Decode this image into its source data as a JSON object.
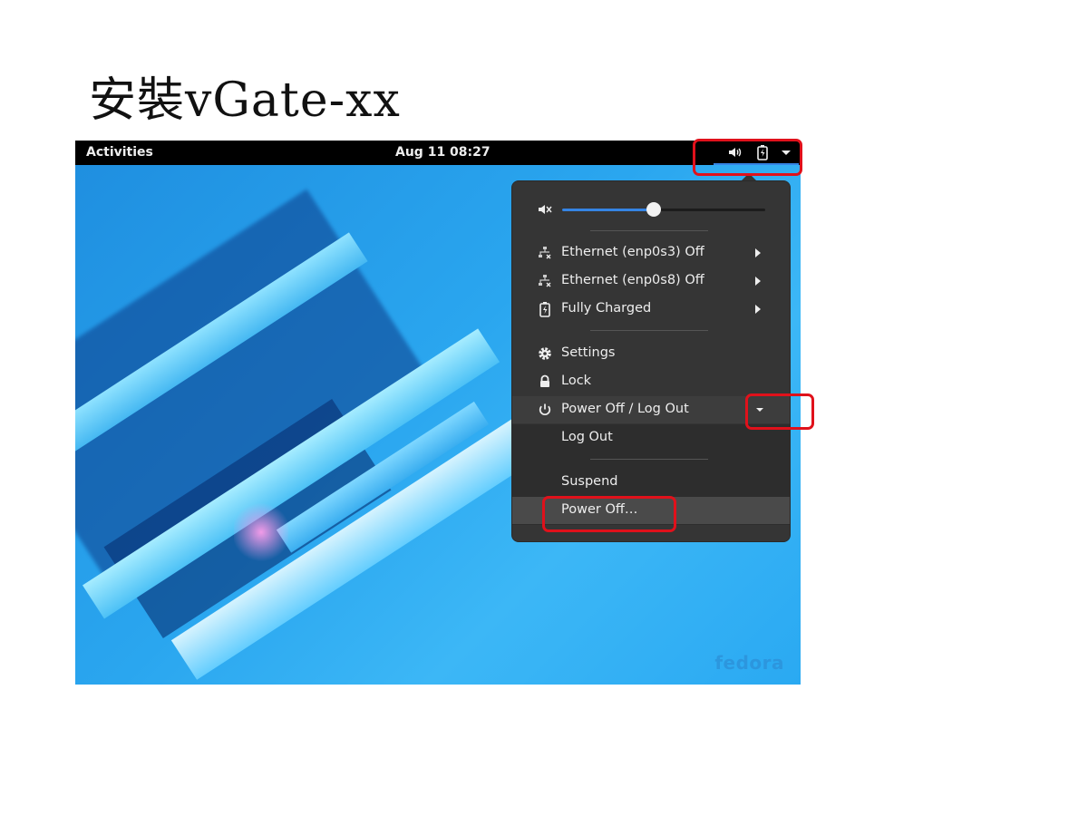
{
  "slide": {
    "title": "安裝vGate-xx"
  },
  "topbar": {
    "activities": "Activities",
    "clock": "Aug 11  08:27",
    "tray_icons": [
      "speaker-icon",
      "battery-icon",
      "dropdown-arrow-icon"
    ]
  },
  "menu": {
    "volume": {
      "icon": "speaker-muted-icon",
      "level": 0.45
    },
    "network": [
      {
        "label": "Ethernet (enp0s3) Off",
        "icon": "network-wired-disconnected-icon"
      },
      {
        "label": "Ethernet (enp0s8) Off",
        "icon": "network-wired-disconnected-icon"
      }
    ],
    "battery": {
      "label": "Fully Charged",
      "icon": "battery-charged-icon"
    },
    "settings": {
      "label": "Settings",
      "icon": "gear-icon"
    },
    "lock": {
      "label": "Lock",
      "icon": "lock-icon"
    },
    "power": {
      "label": "Power Off / Log Out",
      "icon": "power-icon",
      "expanded": true
    },
    "power_submenu": {
      "log_out": "Log Out",
      "suspend": "Suspend",
      "power_off": "Power Off…"
    }
  },
  "desktop": {
    "watermark": "fedora"
  },
  "colors": {
    "accent": "#3584e4",
    "callout": "#e0111b",
    "menu_bg": "#353535",
    "topbar_bg": "#000000"
  }
}
